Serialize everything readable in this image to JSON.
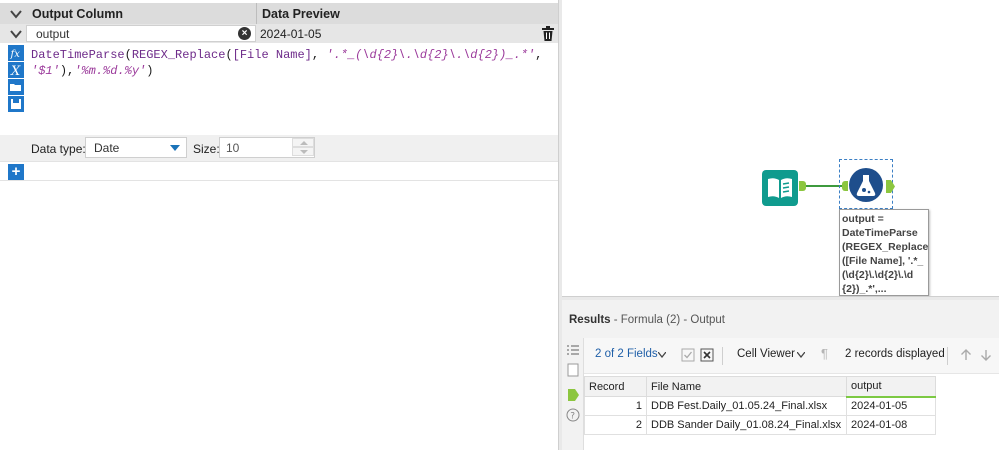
{
  "formula_panel": {
    "col_header": {
      "output_column": "Output Column",
      "data_preview": "Data Preview"
    },
    "field": {
      "name": "output",
      "preview": "2024-01-05"
    },
    "expression": {
      "line1": {
        "fn1": "DateTimeParse",
        "p1": "(",
        "fn2": "REGEX_Replace",
        "p2": "(",
        "field": "[File Name]",
        "p3": ", ",
        "str1": "'.*_(\\d{2}\\.\\d{2}\\.\\d{2})_.*'",
        "p4": ","
      },
      "line2": {
        "str2": "'$1'",
        "p5": "),",
        "str3": "'%m.%d.%y'",
        "p6": ")"
      }
    },
    "data_type_label": "Data type:",
    "data_type_value": "Date",
    "size_label": "Size:",
    "size_value": "10"
  },
  "canvas": {
    "annotation": "output =\nDateTimeParse\n(REGEX_Replace\n([File Name], '.*_\n(\\d{2}\\.\\d{2}\\.\\d\n{2})_.*',..."
  },
  "results": {
    "title_strong": "Results",
    "title_rest": " - Formula (2) - Output",
    "fields_label": "2 of 2 Fields",
    "cell_viewer": "Cell Viewer",
    "records_displayed": "2 records displayed",
    "columns": [
      "Record",
      "File Name",
      "output"
    ],
    "rows": [
      {
        "record": "1",
        "file_name": "DDB Fest.Daily_01.05.24_Final.xlsx",
        "output": "2024-01-05"
      },
      {
        "record": "2",
        "file_name": "DDB Sander Daily_01.08.24_Final.xlsx",
        "output": "2024-01-08"
      }
    ]
  },
  "colors": {
    "accent_blue": "#1f77c9",
    "connector_green": "#8cc63f",
    "tool_teal": "#0f9b8e",
    "formula_navy": "#1e4e8c"
  }
}
